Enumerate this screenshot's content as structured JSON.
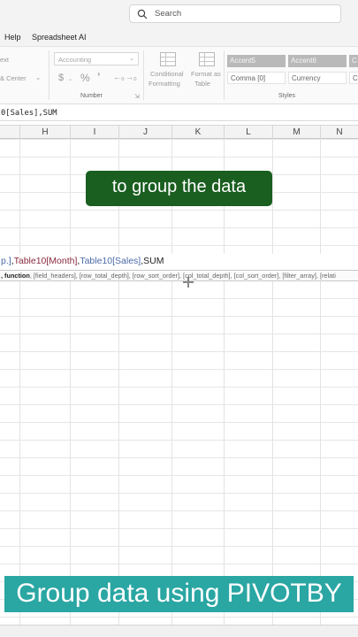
{
  "search": {
    "placeholder": "Search"
  },
  "menu": {
    "items": [
      "Help",
      "Spreadsheet AI"
    ]
  },
  "ribbon": {
    "alignment": {
      "text_label": "ext",
      "merge_label": "& Center"
    },
    "number": {
      "format_value": "Accounting",
      "dollar": "$",
      "percent": "%",
      "comma": "Œ",
      "group_label": "Number"
    },
    "styles": {
      "conditional": [
        "Conditional",
        "Formatting"
      ],
      "format_table": [
        "Format as",
        "Table"
      ],
      "cells": [
        "Accent5",
        "Accent6",
        "C",
        "Comma [0]",
        "Currency",
        "C"
      ],
      "group_label": "Styles"
    }
  },
  "formula_bar": {
    "text": "0[Sales],SUM"
  },
  "columns": [
    "H",
    "I",
    "J",
    "K",
    "L",
    "M",
    "N"
  ],
  "caption_top": "to group the data",
  "formula_cell": {
    "seg1": "p.]",
    "seg2": ",",
    "seg3": "Table10[Month]",
    "seg4": ",",
    "seg5": "Table10[Sales]",
    "seg6": ",SUM"
  },
  "tooltip": {
    "bold": ", function",
    "rest": ", [field_headers], [row_total_depth], [row_sort_order], [col_total_depth], [col_sort_order], [filter_array], [relati"
  },
  "caption_bottom": "Group data using PIVOTBY"
}
